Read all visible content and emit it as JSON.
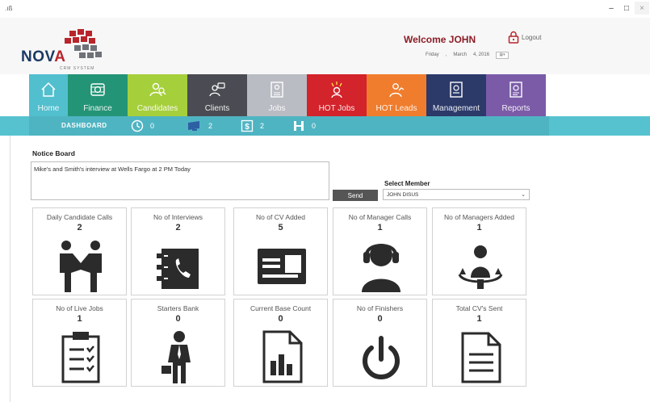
{
  "titlebar": {
    "app_icon": ".ıß",
    "min": "–",
    "max": "□",
    "close": "×"
  },
  "header": {
    "logo_word_pre": "NOV",
    "logo_word_a": "A",
    "logo_sub": "CRM SYSTEM",
    "welcome": "Welcome  JOHN",
    "logout": "Logout",
    "date": {
      "day": "Friday",
      "month": "March",
      "daynum": "4, 2016"
    }
  },
  "nav": {
    "items": [
      {
        "label": "Home",
        "color": "#52bfce",
        "icon": "home-icon"
      },
      {
        "label": "Finance",
        "color": "#249476",
        "icon": "money-icon"
      },
      {
        "label": "Candidates",
        "color": "#a6cf3c",
        "icon": "candidate-icon"
      },
      {
        "label": "Clients",
        "color": "#4b4c53",
        "icon": "clients-icon"
      },
      {
        "label": "Jobs",
        "color": "#b9bcc3",
        "icon": "jobs-icon"
      },
      {
        "label": "HOT Jobs",
        "color": "#d3232b",
        "icon": "hot-jobs-icon"
      },
      {
        "label": "HOT Leads",
        "color": "#f07d2d",
        "icon": "hot-leads-icon"
      },
      {
        "label": "Management",
        "color": "#2c3a6a",
        "icon": "management-icon"
      },
      {
        "label": "Reports",
        "color": "#7b5ba8",
        "icon": "reports-icon"
      }
    ]
  },
  "dashbar": {
    "label": "DASHBOARD",
    "stats": [
      {
        "icon": "clock-icon",
        "value": "0"
      },
      {
        "icon": "monitor-icon",
        "value": "2"
      },
      {
        "icon": "dollar-icon",
        "value": "2"
      },
      {
        "icon": "barbell-icon",
        "value": "0"
      }
    ]
  },
  "notice": {
    "title": "Notice Board",
    "text": "Mike's and Smith's interview at Wells Fargo at 2 PM Today",
    "send": "Send",
    "select_label": "Select Member",
    "select_value": "JOHN DISUS"
  },
  "cards": [
    {
      "title": "Daily Candidate Calls",
      "count": "2",
      "icon": "handshake-icon"
    },
    {
      "title": "No of Interviews",
      "count": "2",
      "icon": "phonebook-icon"
    },
    {
      "title": "No of CV Added",
      "count": "5",
      "icon": "idcard-icon"
    },
    {
      "title": "No of Manager Calls",
      "count": "1",
      "icon": "headset-icon"
    },
    {
      "title": "No of Managers Added",
      "count": "1",
      "icon": "manager-icon"
    },
    {
      "title": "No of Live Jobs",
      "count": "1",
      "icon": "clipboard-icon"
    },
    {
      "title": "Starters Bank",
      "count": "0",
      "icon": "briefcase-person-icon"
    },
    {
      "title": "Current Base Count",
      "count": "0",
      "icon": "report-chart-icon"
    },
    {
      "title": "No of Finishers",
      "count": "0",
      "icon": "power-icon"
    },
    {
      "title": "Total CV's Sent",
      "count": "1",
      "icon": "document-icon"
    }
  ]
}
